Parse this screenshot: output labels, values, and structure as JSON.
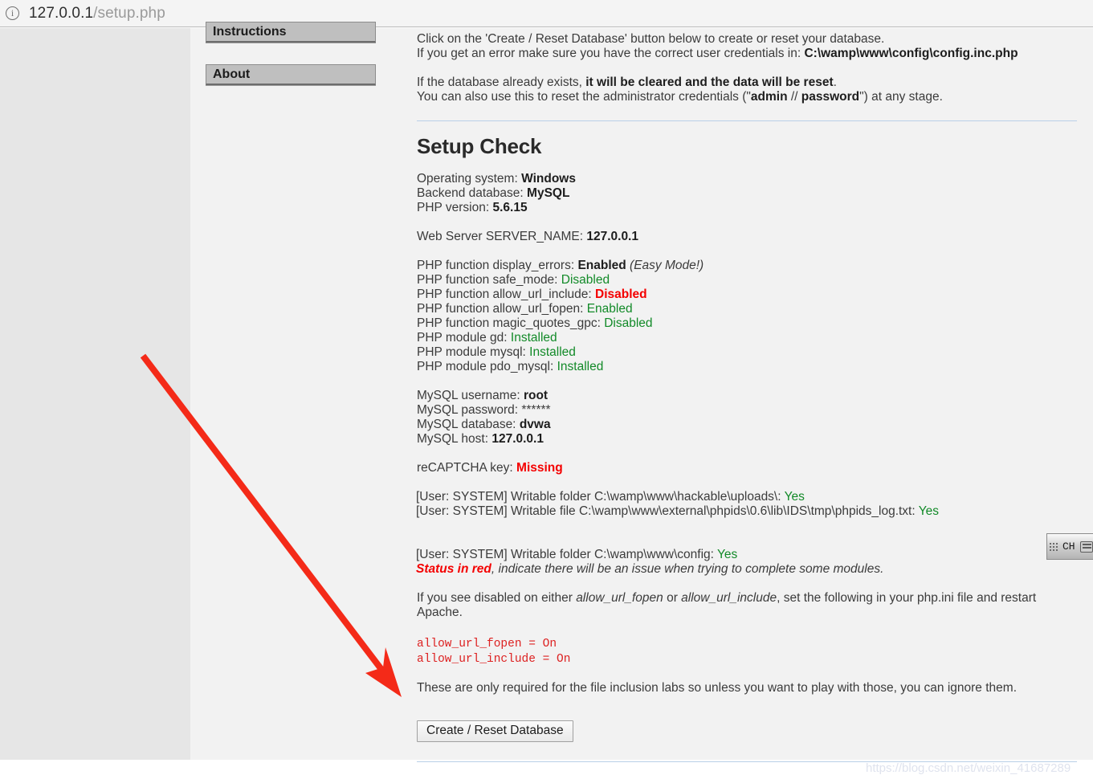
{
  "browser": {
    "info_icon": "info-icon",
    "url_host": "127.0.0.1",
    "url_path": "/setup.php"
  },
  "sidebar": {
    "items": [
      {
        "label": "Instructions"
      },
      {
        "label": "About"
      }
    ]
  },
  "intro": {
    "line1": "Click on the 'Create / Reset Database' button below to create or reset your database.",
    "line2_prefix": "If you get an error make sure you have the correct user credentials in: ",
    "line2_path": "C:\\wamp\\www\\config\\config.inc.php",
    "line3_prefix": "If the database already exists, ",
    "line3_bold": "it will be cleared and the data will be reset",
    "line3_suffix": ".",
    "line4_prefix": "You can also use this to reset the administrator credentials (\"",
    "line4_admin": "admin",
    "line4_mid": " // ",
    "line4_password": "password",
    "line4_suffix": "\") at any stage."
  },
  "setup_check": {
    "heading": "Setup Check",
    "system": [
      {
        "label": "Operating system: ",
        "value": "Windows",
        "style": "bold"
      },
      {
        "label": "Backend database: ",
        "value": "MySQL",
        "style": "bold"
      },
      {
        "label": "PHP version: ",
        "value": "5.6.15",
        "style": "bold"
      }
    ],
    "server": {
      "label": "Web Server SERVER_NAME: ",
      "value": "127.0.0.1",
      "style": "bold"
    },
    "php_checks": [
      {
        "label": "PHP function display_errors: ",
        "value": "Enabled",
        "style": "bold",
        "note": " (Easy Mode!)"
      },
      {
        "label": "PHP function safe_mode: ",
        "value": "Disabled",
        "style": "green"
      },
      {
        "label": "PHP function allow_url_include: ",
        "value": "Disabled",
        "style": "red"
      },
      {
        "label": "PHP function allow_url_fopen: ",
        "value": "Enabled",
        "style": "green"
      },
      {
        "label": "PHP function magic_quotes_gpc: ",
        "value": "Disabled",
        "style": "green"
      },
      {
        "label": "PHP module gd: ",
        "value": "Installed",
        "style": "green"
      },
      {
        "label": "PHP module mysql: ",
        "value": "Installed",
        "style": "green"
      },
      {
        "label": "PHP module pdo_mysql: ",
        "value": "Installed",
        "style": "green"
      }
    ],
    "mysql": [
      {
        "label": "MySQL username: ",
        "value": "root",
        "style": "bold"
      },
      {
        "label": "MySQL password: ",
        "value": "******",
        "style": "plain"
      },
      {
        "label": "MySQL database: ",
        "value": "dvwa",
        "style": "bold"
      },
      {
        "label": "MySQL host: ",
        "value": "127.0.0.1",
        "style": "bold"
      }
    ],
    "recaptcha": {
      "label": "reCAPTCHA key: ",
      "value": "Missing",
      "style": "red"
    },
    "filesystem": [
      {
        "label": "[User: SYSTEM] Writable folder C:\\wamp\\www\\hackable\\uploads\\: ",
        "value": "Yes",
        "style": "green"
      },
      {
        "label": "[User: SYSTEM] Writable file C:\\wamp\\www\\external\\phpids\\0.6\\lib\\IDS\\tmp\\phpids_log.txt: ",
        "value": "Yes",
        "style": "green"
      }
    ],
    "filesystem_config": {
      "label": "[User: SYSTEM] Writable folder C:\\wamp\\www\\config: ",
      "value": "Yes",
      "style": "green"
    },
    "status_note_red": "Status in red",
    "status_note_rest": ", indicate there will be an issue when trying to complete some modules.",
    "ini_note_1": "If you see disabled on either ",
    "ini_note_fopen": "allow_url_fopen",
    "ini_note_2": " or ",
    "ini_note_include": "allow_url_include",
    "ini_note_3": ", set the following in your php.ini file and restart Apache.",
    "ini_lines": [
      "allow_url_fopen = On",
      "allow_url_include = On"
    ],
    "final_note": "These are only required for the file inclusion labs so unless you want to play with those, you can ignore them."
  },
  "actions": {
    "create_reset_label": "Create / Reset Database"
  },
  "annotation": {
    "arrow_color": "#f42a18"
  },
  "ime": {
    "grip": "drag-grip-icon",
    "language": "CH",
    "keyboard_icon": "keyboard-icon"
  },
  "watermark": {
    "text": "https://blog.csdn.net/weixin_41687289"
  },
  "colors": {
    "ok_green": "#128a28",
    "error_red": "#f40000",
    "code_red": "#dd2222",
    "rule_blue": "#b9cfe7"
  }
}
